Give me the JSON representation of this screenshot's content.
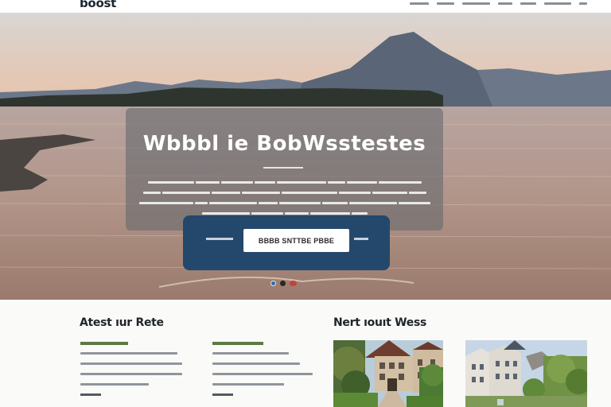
{
  "brand": {
    "logo": "boost"
  },
  "nav": {
    "items": [
      "",
      "",
      "",
      "",
      "",
      ""
    ]
  },
  "hero": {
    "title": "Wbbbl ie BobWsstestes",
    "paragraph_lines": [
      "",
      "",
      "",
      ""
    ],
    "cta": {
      "left_label": "",
      "button_label": "BBBB SNTTBE PBBE",
      "right_label": ""
    },
    "carousel_dots": 2
  },
  "latest": {
    "title": "Atest ıur Rete",
    "cards": [
      {
        "heading": "",
        "lines": [
          "",
          "",
          "",
          ""
        ]
      },
      {
        "heading": "",
        "lines": [
          "",
          "",
          "",
          ""
        ]
      }
    ]
  },
  "news": {
    "title": "Nert ıouıt Wess"
  },
  "colors": {
    "cta_panel": "#24486b",
    "card_heading": "#4f6b3c"
  }
}
